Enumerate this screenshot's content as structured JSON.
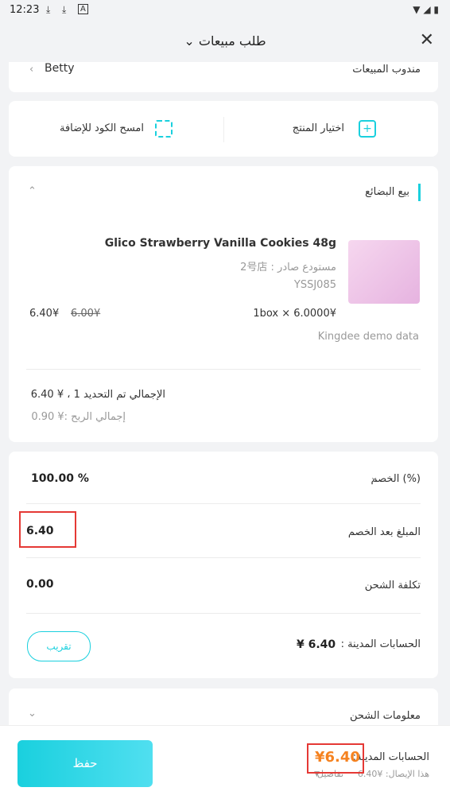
{
  "status_bar": {
    "time": "12:23"
  },
  "header": {
    "title": "طلب مبيعات",
    "title_chevron": "⌄",
    "close": "✕"
  },
  "top_row": {
    "label": "مندوب المبيعات",
    "value": "Betty",
    "chevron": "‹"
  },
  "actions": {
    "choose_product": "اختيار المنتج",
    "scan_code": "امسح الكود للإضافة"
  },
  "goods": {
    "section_title": "بيع البضائع",
    "product": {
      "name": "Glico Strawberry Vanilla Cookies 48g",
      "warehouse": "مستودع صادر : 2号店",
      "code": "YSSJ085",
      "qty_price": "1box × 6.0000¥",
      "price": "6.40¥",
      "old_price": "6.00¥",
      "brand": "Kingdee demo data"
    },
    "total_label": "الإجمالي تم التحديد 1 ، ¥ 6.40",
    "total_profit": "إجمالي الربح :¥ 0.90"
  },
  "discount": {
    "rows": [
      {
        "label": "الخصم (%)",
        "value": "100.00 %"
      },
      {
        "label": "المبلغ بعد الخصم",
        "value": "6.40"
      },
      {
        "label": "تكلفة الشحن",
        "value": "0.00"
      }
    ],
    "receivable_label": "الحسابات المدينة :",
    "receivable_value": "¥ 6.40",
    "round_button": "تقريب"
  },
  "shipping": {
    "label": "معلومات الشحن"
  },
  "bottom": {
    "save": "حفظ",
    "receivable_label": "الحسابات المدينة:",
    "receivable_amount": "¥6.40",
    "receipt_line": "هذا الإيصال: ¥6.40",
    "details": "تفاصيل"
  }
}
